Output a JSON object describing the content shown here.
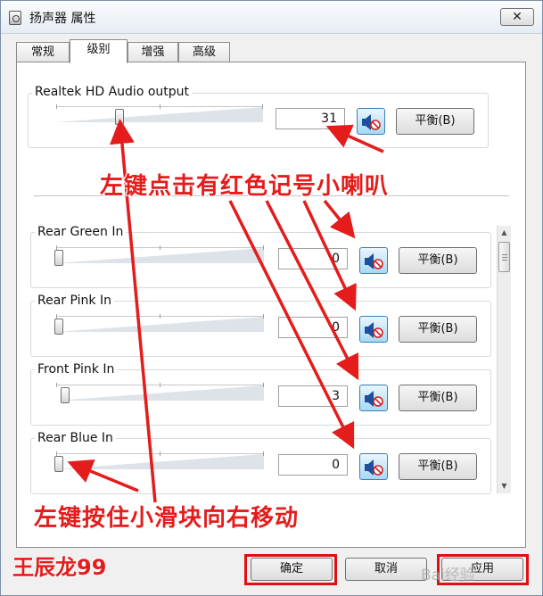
{
  "window": {
    "title": "扬声器 属性",
    "close_glyph": "✕"
  },
  "tabs": [
    {
      "label": "常规",
      "active": false
    },
    {
      "label": "级别",
      "active": true
    },
    {
      "label": "增强",
      "active": false
    },
    {
      "label": "高级",
      "active": false
    }
  ],
  "main_output": {
    "label": "Realtek HD Audio output",
    "value": "31",
    "balance_label": "平衡(B)"
  },
  "channels": [
    {
      "label": "Rear Green In",
      "value": "0",
      "balance_label": "平衡(B)"
    },
    {
      "label": "Rear Pink In",
      "value": "0",
      "balance_label": "平衡(B)"
    },
    {
      "label": "Front Pink In",
      "value": "3",
      "balance_label": "平衡(B)"
    },
    {
      "label": "Rear Blue In",
      "value": "0",
      "balance_label": "平衡(B)"
    }
  ],
  "footer": {
    "ok_label": "确定",
    "cancel_label": "取消",
    "apply_label": "应用"
  },
  "annotations": {
    "top_note": "左键点击有红色记号小喇叭",
    "bottom_note": "左键按住小滑块向右移动",
    "author": "王辰龙99",
    "watermark": "Bai经验"
  },
  "colors": {
    "annotation_red": "#e41c1c",
    "mute_button_blue": "#a7d9f5",
    "muted_badge": "#d42020"
  },
  "icons": {
    "mute": "speaker-muted-icon",
    "close": "close-icon",
    "window": "speaker-properties-icon"
  }
}
